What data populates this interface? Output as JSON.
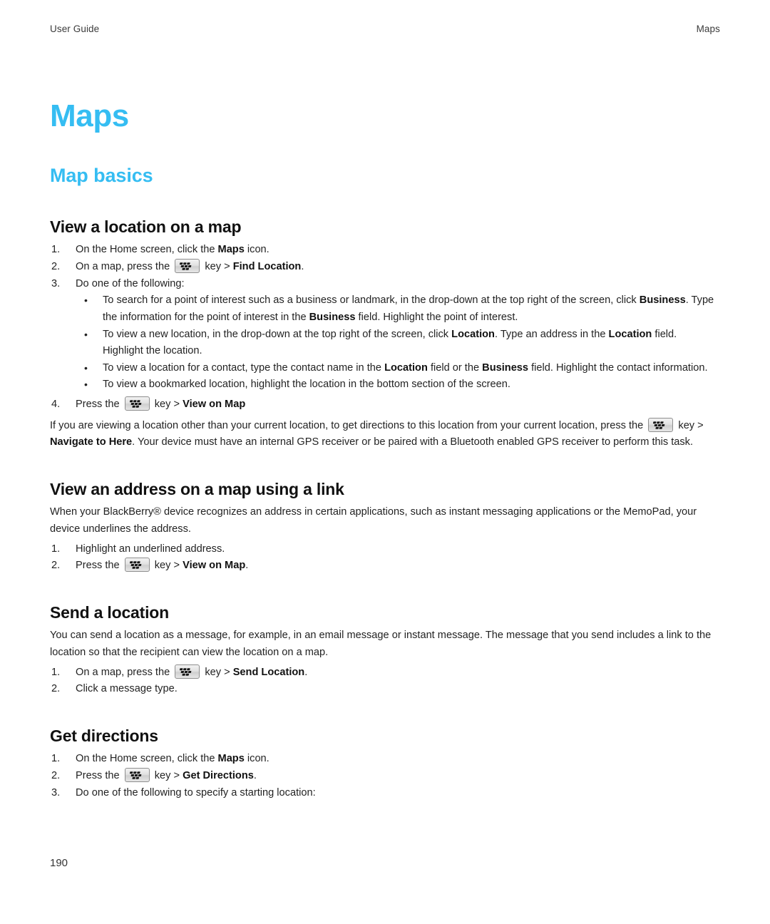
{
  "header": {
    "left": "User Guide",
    "right": "Maps"
  },
  "doc": {
    "title": "Maps",
    "section_title": "Map basics",
    "accent_color": "#35BDF2",
    "page_number": "190"
  },
  "icons": {
    "menu_key": "blackberry-menu-key-icon"
  },
  "sections": [
    {
      "heading": "View a location on a map",
      "steps": [
        {
          "num": "1.",
          "parts": [
            {
              "t": "text",
              "v": "On the Home screen, click the "
            },
            {
              "t": "bold",
              "v": "Maps"
            },
            {
              "t": "text",
              "v": " icon."
            }
          ]
        },
        {
          "num": "2.",
          "parts": [
            {
              "t": "text",
              "v": "On a map, press the "
            },
            {
              "t": "key"
            },
            {
              "t": "text",
              "v": " key > "
            },
            {
              "t": "bold",
              "v": "Find Location"
            },
            {
              "t": "text",
              "v": "."
            }
          ]
        },
        {
          "num": "3.",
          "parts": [
            {
              "t": "text",
              "v": "Do one of the following:"
            }
          ]
        }
      ],
      "bullets": [
        [
          {
            "t": "text",
            "v": "To search for a point of interest such as a business or landmark, in the drop-down at the top right of the screen, click "
          },
          {
            "t": "bold",
            "v": "Business"
          },
          {
            "t": "text",
            "v": ". Type the information for the point of interest in the "
          },
          {
            "t": "bold",
            "v": "Business"
          },
          {
            "t": "text",
            "v": " field. Highlight the point of interest."
          }
        ],
        [
          {
            "t": "text",
            "v": "To view a new location, in the drop-down at the top right of the screen, click "
          },
          {
            "t": "bold",
            "v": "Location"
          },
          {
            "t": "text",
            "v": ". Type an address in the "
          },
          {
            "t": "bold",
            "v": "Location"
          },
          {
            "t": "text",
            "v": " field. Highlight the location."
          }
        ],
        [
          {
            "t": "text",
            "v": "To view a location for a contact, type the contact name in the "
          },
          {
            "t": "bold",
            "v": "Location"
          },
          {
            "t": "text",
            "v": " field or the "
          },
          {
            "t": "bold",
            "v": "Business"
          },
          {
            "t": "text",
            "v": " field. Highlight the contact information."
          }
        ],
        [
          {
            "t": "text",
            "v": "To view a bookmarked location, highlight the location in the bottom section of the screen."
          }
        ]
      ],
      "steps_after": [
        {
          "num": "4.",
          "parts": [
            {
              "t": "text",
              "v": "Press the "
            },
            {
              "t": "key"
            },
            {
              "t": "text",
              "v": " key > "
            },
            {
              "t": "bold",
              "v": "View on Map"
            }
          ]
        }
      ],
      "note": [
        {
          "t": "text",
          "v": "If you are viewing a location other than your current location, to get directions to this location from your current location, press the "
        },
        {
          "t": "key"
        },
        {
          "t": "text",
          "v": " key > "
        },
        {
          "t": "bold",
          "v": "Navigate to Here"
        },
        {
          "t": "text",
          "v": ". Your device must have an internal GPS receiver or be paired with a Bluetooth enabled GPS receiver to perform this task."
        }
      ]
    },
    {
      "heading": "View an address on a map using a link",
      "intro": [
        {
          "t": "text",
          "v": "When your BlackBerry® device recognizes an address in certain applications, such as instant messaging applications or the MemoPad, your device underlines the address."
        }
      ],
      "steps": [
        {
          "num": "1.",
          "parts": [
            {
              "t": "text",
              "v": "Highlight an underlined address."
            }
          ]
        },
        {
          "num": "2.",
          "parts": [
            {
              "t": "text",
              "v": "Press the "
            },
            {
              "t": "key"
            },
            {
              "t": "text",
              "v": " key > "
            },
            {
              "t": "bold",
              "v": "View on Map"
            },
            {
              "t": "text",
              "v": "."
            }
          ]
        }
      ]
    },
    {
      "heading": "Send a location",
      "intro": [
        {
          "t": "text",
          "v": "You can send a location as a message, for example, in an email message or instant message. The message that you send includes a link to the location so that the recipient can view the location on a map."
        }
      ],
      "steps": [
        {
          "num": "1.",
          "parts": [
            {
              "t": "text",
              "v": "On a map, press the "
            },
            {
              "t": "key"
            },
            {
              "t": "text",
              "v": " key > "
            },
            {
              "t": "bold",
              "v": "Send Location"
            },
            {
              "t": "text",
              "v": "."
            }
          ]
        },
        {
          "num": "2.",
          "parts": [
            {
              "t": "text",
              "v": "Click a message type."
            }
          ]
        }
      ]
    },
    {
      "heading": "Get directions",
      "steps": [
        {
          "num": "1.",
          "parts": [
            {
              "t": "text",
              "v": "On the Home screen, click the "
            },
            {
              "t": "bold",
              "v": "Maps"
            },
            {
              "t": "text",
              "v": " icon."
            }
          ]
        },
        {
          "num": "2.",
          "parts": [
            {
              "t": "text",
              "v": "Press the "
            },
            {
              "t": "key"
            },
            {
              "t": "text",
              "v": " key > "
            },
            {
              "t": "bold",
              "v": "Get Directions"
            },
            {
              "t": "text",
              "v": "."
            }
          ]
        },
        {
          "num": "3.",
          "parts": [
            {
              "t": "text",
              "v": "Do one of the following to specify a starting location:"
            }
          ]
        }
      ]
    }
  ]
}
